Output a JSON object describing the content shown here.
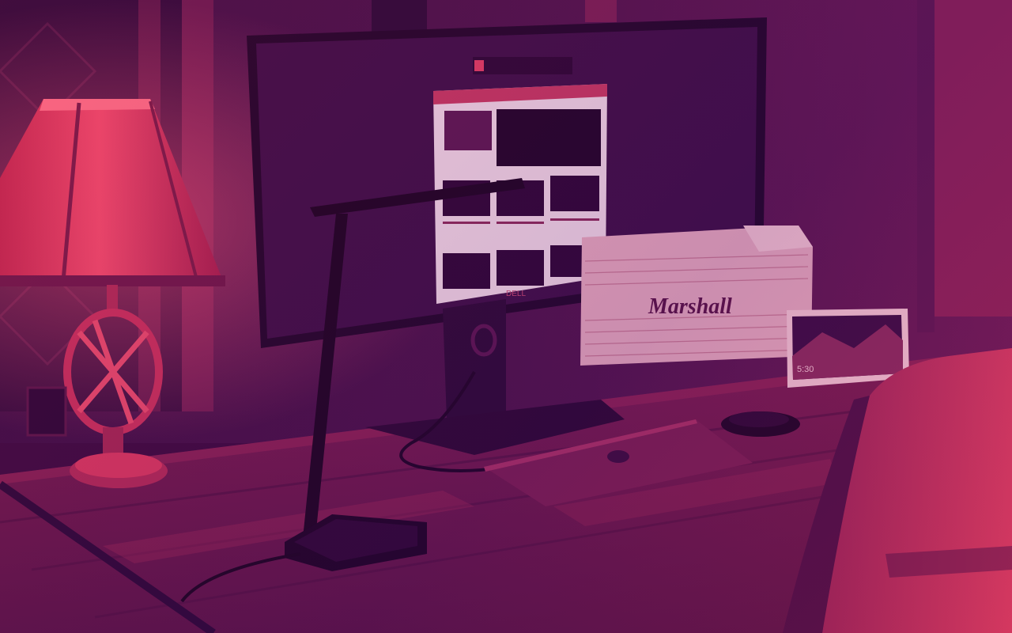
{
  "photo": {
    "speaker_brand": "Marshall",
    "monitor_brand": "DELL",
    "display_time": "5:30",
    "colors": {
      "duotone_light": "#e2325e",
      "duotone_dark": "#3b0d4a",
      "wall": "#4a1248",
      "desk": "#8a2052"
    }
  }
}
